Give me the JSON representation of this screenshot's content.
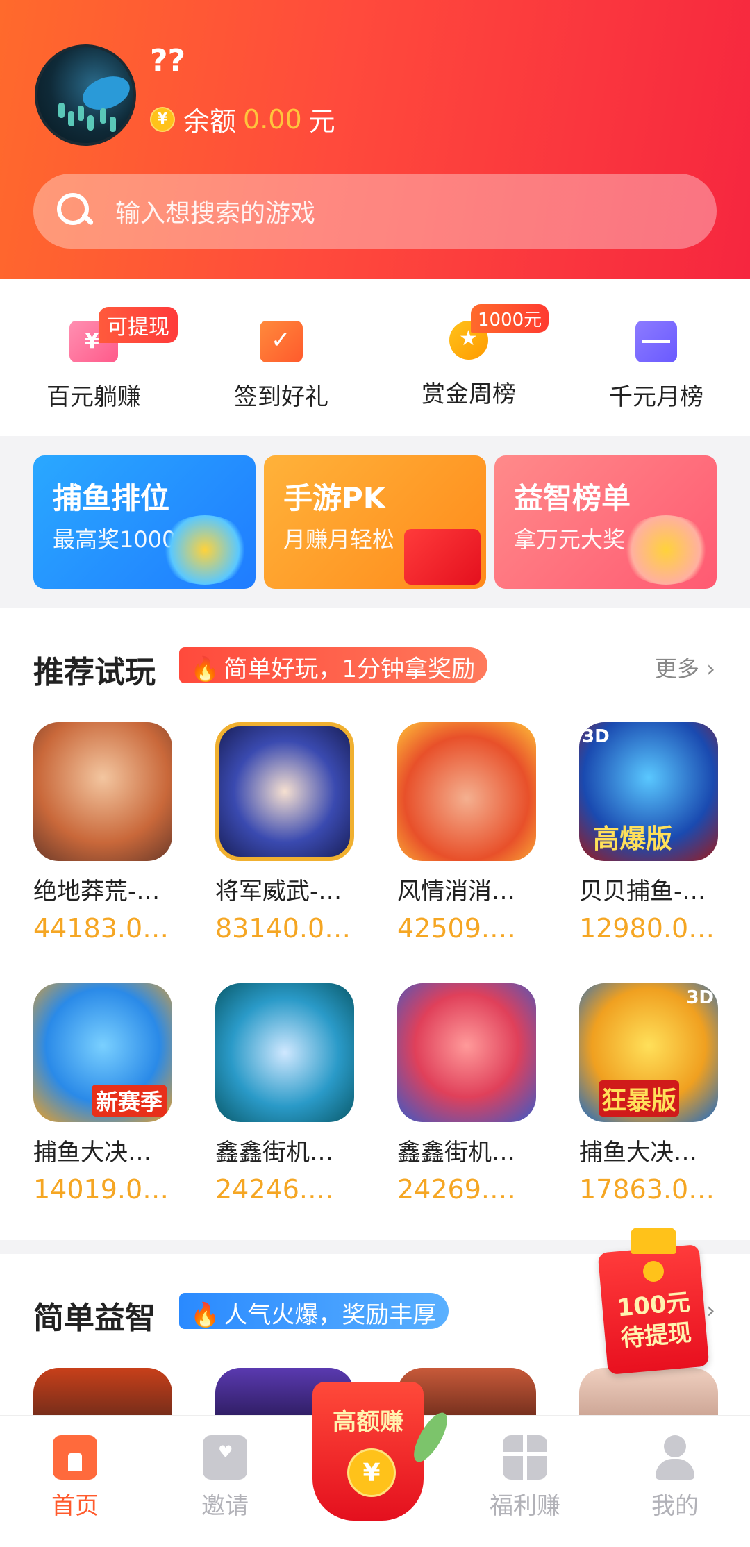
{
  "header": {
    "username": "??",
    "balance_label": "余额",
    "balance_amount": "0.00",
    "balance_unit": "元",
    "search_placeholder": "输入想搜索的游戏"
  },
  "quick": [
    {
      "label": "百元躺赚",
      "badge": "可提现",
      "icon": "wallet-icon"
    },
    {
      "label": "签到好礼",
      "badge": "",
      "icon": "calendar-check-icon"
    },
    {
      "label": "赏金周榜",
      "badge": "1000元",
      "icon": "medal-icon"
    },
    {
      "label": "千元月榜",
      "badge": "",
      "icon": "envelope-icon"
    }
  ],
  "banners": [
    {
      "title": "捕鱼排位",
      "sub": "最高奖1000"
    },
    {
      "title": "手游PK",
      "sub": "月赚月轻松"
    },
    {
      "title": "益智榜单",
      "sub": "拿万元大奖"
    }
  ],
  "recommend": {
    "title": "推荐试玩",
    "tag": "简单好玩，1分钟拿奖励",
    "more": "更多",
    "games": [
      {
        "name": "绝地莽荒-…",
        "value": "44183.0…"
      },
      {
        "name": "将军威武-…",
        "value": "83140.0…"
      },
      {
        "name": "风情消消…",
        "value": "42509.…"
      },
      {
        "name": "贝贝捕鱼-…",
        "value": "12980.0…"
      },
      {
        "name": "捕鱼大决…",
        "value": "14019.0…"
      },
      {
        "name": "鑫鑫街机…",
        "value": "24246.…"
      },
      {
        "name": "鑫鑫街机…",
        "value": "24269.…"
      },
      {
        "name": "捕鱼大决…",
        "value": "17863.0…"
      }
    ],
    "icon_texts": {
      "g4": "高爆版",
      "g4b": "3D",
      "g5": "新赛季",
      "g8": "狂暴版",
      "g8b": "3D"
    }
  },
  "puzzle": {
    "title": "简单益智",
    "tag": "人气火爆，奖励丰厚"
  },
  "float_pack": {
    "line1": "100元",
    "line2": "待提现"
  },
  "tabbar": {
    "home": "首页",
    "invite": "邀请",
    "center": "高额赚",
    "welfare": "福利赚",
    "mine": "我的",
    "center_coin": "¥"
  },
  "colors": {
    "accent": "#ff5a2c",
    "gold": "#f5a623",
    "header_start": "#ff6a2c",
    "header_end": "#f6263f"
  }
}
